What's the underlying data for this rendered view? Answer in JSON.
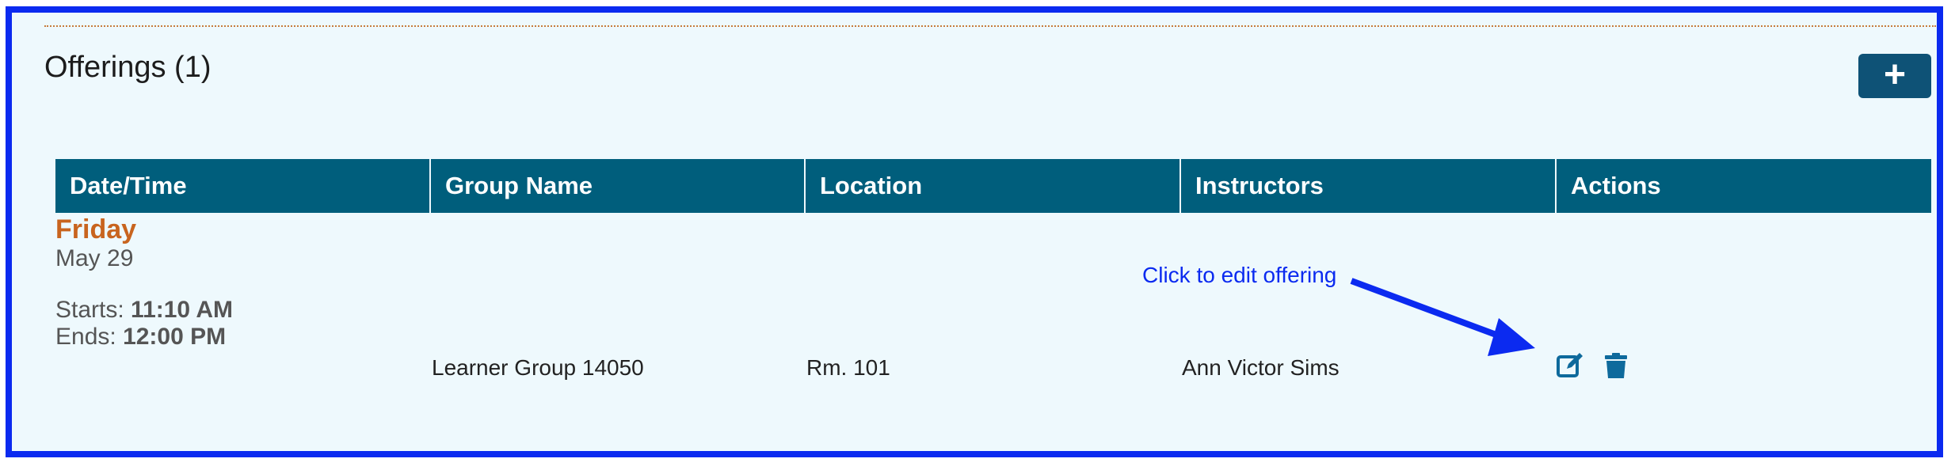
{
  "offerings": {
    "title": "Offerings (1)",
    "add_label": "+",
    "columns": [
      "Date/Time",
      "Group Name",
      "Location",
      "Instructors",
      "Actions"
    ],
    "rows": [
      {
        "day": "Friday",
        "date": "May 29",
        "starts_label": "Starts:",
        "starts": "11:10 AM",
        "ends_label": "Ends:",
        "ends": "12:00 PM",
        "group": "Learner Group 14050",
        "location": "Rm. 101",
        "instructors": "Ann Victor Sims",
        "actions": [
          "edit-icon",
          "trash-icon"
        ]
      }
    ]
  },
  "annotation": {
    "text": "Click to edit offering",
    "color": "#0b2af0"
  },
  "colors": {
    "header_bg": "#005e7c",
    "day": "#c8641e",
    "add_button": "#0e5276",
    "panel_bg": "#eef9fd"
  }
}
